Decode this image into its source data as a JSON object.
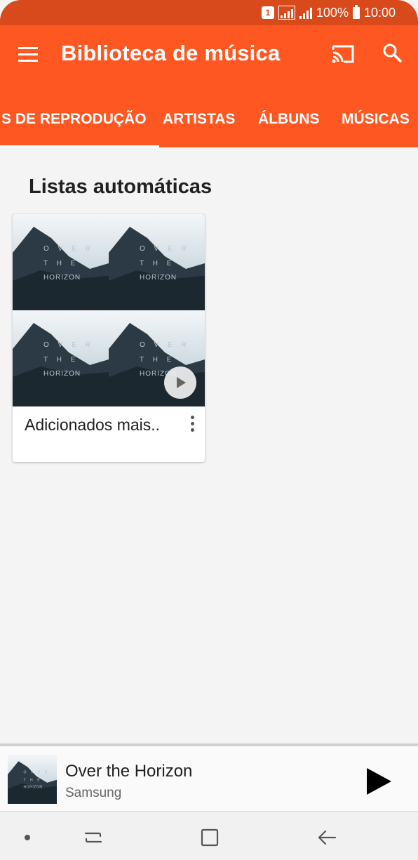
{
  "status_bar": {
    "sim": "1",
    "battery": "100%",
    "time": "10:00"
  },
  "app_bar": {
    "title": "Biblioteca de música",
    "icons": [
      "menu-icon",
      "cast-icon",
      "search-icon"
    ]
  },
  "tabs": [
    {
      "label": "S DE REPRODUÇÃO",
      "active": true
    },
    {
      "label": "ARTISTAS",
      "active": false
    },
    {
      "label": "ÁLBUNS",
      "active": false
    },
    {
      "label": "MÚSICAS",
      "active": false
    }
  ],
  "content": {
    "section_title": "Listas automáticas",
    "cards": [
      {
        "title": "Adicionados mais..",
        "art_text": [
          "O V E R",
          "T H E",
          "HORIZON"
        ]
      }
    ]
  },
  "now_playing": {
    "title": "Over the Horizon",
    "artist": "Samsung"
  },
  "colors": {
    "status_bar": "#d84a1b",
    "app_bar": "#ff5722",
    "background": "#f4f4f4"
  }
}
